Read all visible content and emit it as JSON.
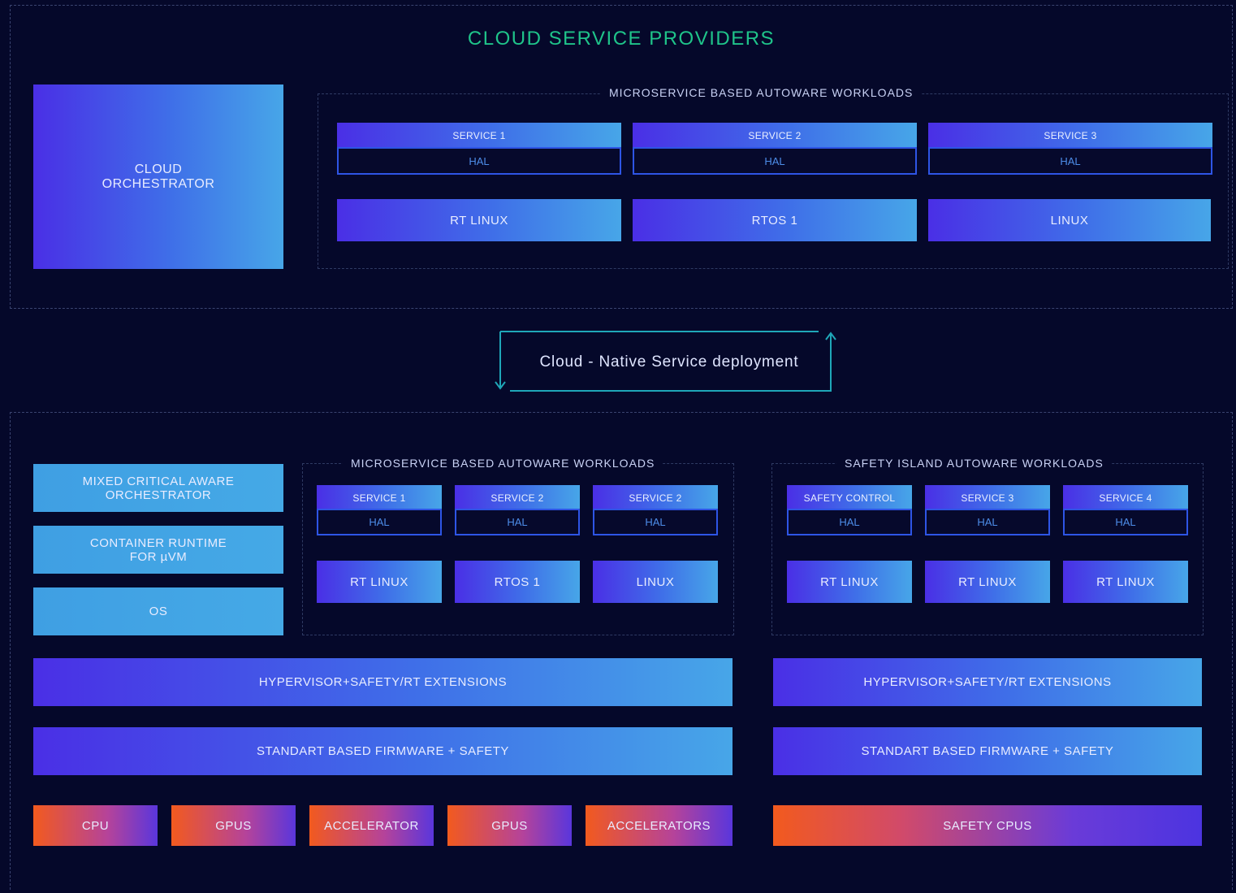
{
  "top": {
    "title": "CLOUD SERVICE PROVIDERS",
    "orchestrator_line1": "CLOUD",
    "orchestrator_line2": "ORCHESTRATOR",
    "workloads_title": "MICROSERVICE BASED AUTOWARE WORKLOADS",
    "services": [
      {
        "service": "SERVICE 1",
        "hal": "HAL",
        "os": "RT LINUX"
      },
      {
        "service": "SERVICE 2",
        "hal": "HAL",
        "os": "RTOS 1"
      },
      {
        "service": "SERVICE 3",
        "hal": "HAL",
        "os": "LINUX"
      }
    ]
  },
  "deployment": {
    "label": "Cloud - Native Service deployment"
  },
  "bottom": {
    "left_stack": {
      "orchestrator_line1": "MIXED CRITICAL AWARE",
      "orchestrator_line2": "ORCHESTRATOR",
      "runtime_line1": "CONTAINER RUNTIME",
      "runtime_line2": "FOR µVM",
      "os": "OS"
    },
    "micro_title": "MICROSERVICE BASED AUTOWARE WORKLOADS",
    "micro_services": [
      {
        "service": "SERVICE 1",
        "hal": "HAL",
        "os": "RT LINUX"
      },
      {
        "service": "SERVICE 2",
        "hal": "HAL",
        "os": "RTOS 1"
      },
      {
        "service": "SERVICE 2",
        "hal": "HAL",
        "os": "LINUX"
      }
    ],
    "safety_title": "SAFETY ISLAND AUTOWARE WORKLOADS",
    "safety_services": [
      {
        "service": "SAFETY CONTROL",
        "hal": "HAL",
        "os": "RT LINUX"
      },
      {
        "service": "SERVICE 3",
        "hal": "HAL",
        "os": "RT LINUX"
      },
      {
        "service": "SERVICE 4",
        "hal": "HAL",
        "os": "RT LINUX"
      }
    ],
    "hypervisor_left": "HYPERVISOR+SAFETY/RT EXTENSIONS",
    "hypervisor_right": "HYPERVISOR+SAFETY/RT EXTENSIONS",
    "firmware_left": "STANDART BASED FIRMWARE + SAFETY",
    "firmware_right": "STANDART BASED FIRMWARE + SAFETY",
    "hardware": [
      "CPU",
      "GPUs",
      "ACCELERATOR",
      "GPUs",
      "ACCELERATORS"
    ],
    "safety_hardware": "SAFETY CPUs"
  },
  "colors": {
    "background": "#05082a",
    "title": "#1fc48a",
    "hal_border": "#2e55e6",
    "accent_line": "#1fa7b8"
  }
}
